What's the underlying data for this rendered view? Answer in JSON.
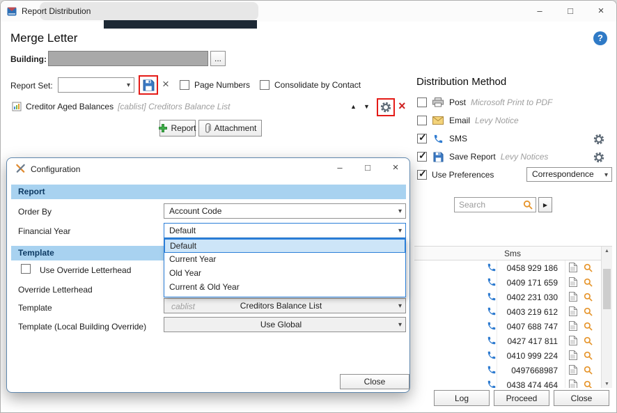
{
  "window": {
    "title": "Report Distribution"
  },
  "icons": {
    "minimize": "–",
    "maximize": "□",
    "close": "×",
    "help": "?",
    "up": "▲",
    "down": "▼",
    "combo": "▾",
    "forward": "▶",
    "clear": "×",
    "delete": "×"
  },
  "header": {
    "title": "Merge Letter"
  },
  "building": {
    "label": "Building:",
    "browse_label": "..."
  },
  "report_set": {
    "label": "Report Set:",
    "page_numbers_label": "Page Numbers",
    "consolidate_label": "Consolidate by Contact"
  },
  "report_item": {
    "name": "Creditor Aged Balances",
    "detail": "[cablist] Creditors Balance List"
  },
  "toolbar": {
    "report_label": "Report",
    "attachment_label": "Attachment"
  },
  "distribution": {
    "title": "Distribution Method",
    "items": [
      {
        "label": "Post",
        "detail": "Microsoft Print to PDF",
        "checked": false
      },
      {
        "label": "Email",
        "detail": "Levy Notice",
        "checked": false
      },
      {
        "label": "SMS",
        "detail": "",
        "checked": true
      },
      {
        "label": "Save Report",
        "detail": "Levy Notices",
        "checked": true
      }
    ],
    "use_preferences_label": "Use Preferences",
    "preference_value": "Correspondence"
  },
  "search": {
    "placeholder": "Search"
  },
  "table": {
    "sms_header": "Sms",
    "rows": [
      {
        "sms": "0458 929 186"
      },
      {
        "sms": "0409 171 659"
      },
      {
        "sms": "0402 231 030"
      },
      {
        "sms": "0403 219 612"
      },
      {
        "sms": "0407 688 747"
      },
      {
        "sms": "0427 417 811"
      },
      {
        "sms": "0410 999 224"
      },
      {
        "sms": "0497668987"
      },
      {
        "sms": "0438 474 464"
      }
    ]
  },
  "footer": {
    "log": "Log",
    "proceed": "Proceed",
    "close": "Close"
  },
  "config": {
    "title": "Configuration",
    "report_section": "Report",
    "template_section": "Template",
    "order_by_label": "Order By",
    "order_by_value": "Account Code",
    "financial_year_label": "Financial Year",
    "financial_year_value": "Default",
    "options": [
      "Default",
      "Current Year",
      "Old Year",
      "Current & Old Year"
    ],
    "use_override_label": "Use Override Letterhead",
    "override_letterhead_label": "Override Letterhead",
    "template_label": "Template",
    "template_prefix": "cablist",
    "template_value": "Creditors Balance List",
    "template_local_label": "Template (Local Building Override)",
    "template_local_value": "Use Global",
    "close_label": "Close"
  },
  "colors": {
    "section_header": "#a8d2f0",
    "annotation_red": "#e41b17",
    "phone_blue": "#2e7bd0",
    "magnifier_orange": "#e6942a"
  }
}
